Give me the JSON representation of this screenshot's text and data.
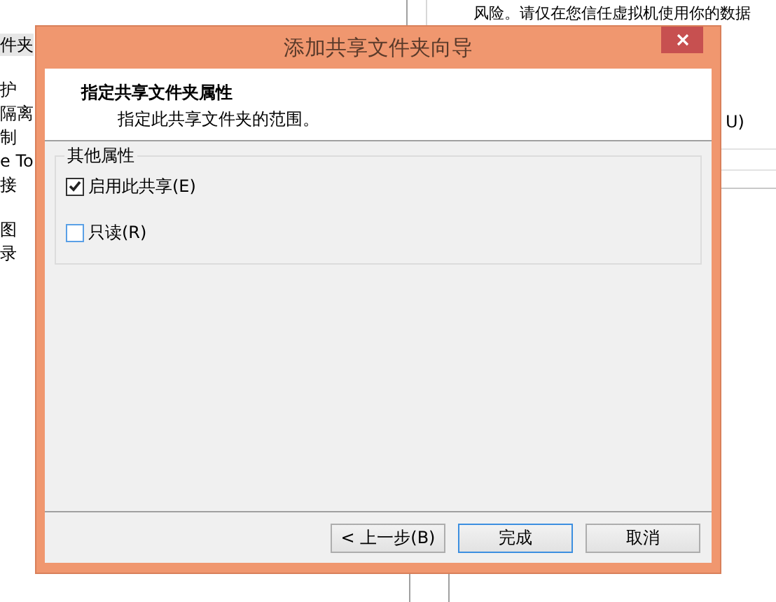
{
  "background_window": {
    "left_items": [
      {
        "label": "件夹",
        "selected": true
      },
      {
        "label": "护",
        "selected": false
      },
      {
        "label": "隔离",
        "selected": false
      },
      {
        "label": "制",
        "selected": false
      },
      {
        "label": "e To",
        "selected": false
      },
      {
        "label": "接",
        "selected": false
      },
      {
        "label": "图",
        "selected": false
      },
      {
        "label": "录",
        "selected": false
      }
    ],
    "warning_lines": [
      "风险。请仅在您信任虚拟机使用你的数据"
    ],
    "option_fragment": "U)"
  },
  "dialog": {
    "title": "添加共享文件夹向导",
    "header": {
      "title": "指定共享文件夹属性",
      "subtitle": "指定此共享文件夹的范围。"
    },
    "group": {
      "title": "其他属性",
      "options": [
        {
          "label": "启用此共享(E)",
          "checked": true
        },
        {
          "label": "只读(R)",
          "checked": false
        }
      ]
    },
    "buttons": [
      {
        "label": "< 上一步(B)",
        "default": false
      },
      {
        "label": "完成",
        "default": true
      },
      {
        "label": "取消",
        "default": false
      }
    ]
  }
}
